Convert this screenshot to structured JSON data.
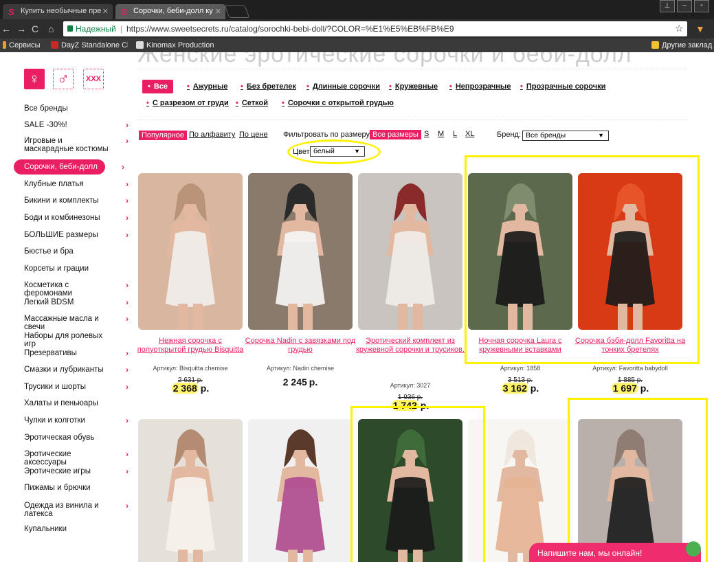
{
  "browser": {
    "tabs": [
      {
        "label": "Купить необычные пре",
        "active": false
      },
      {
        "label": "Сорочки, беби-долл ку",
        "active": true
      }
    ],
    "secure_label": "Надежный",
    "url": "https://www.sweetsecrets.ru/catalog/sorochki-bebi-doll/?COLOR=%E1%E5%EB%FB%E9",
    "bookmarks": [
      "Сервисы",
      "DayZ Standalone Che",
      "Kinomax Production"
    ],
    "other_bookmarks": "Другие заклад"
  },
  "page": {
    "heading": "Женские эротические сорочки и беби-долл"
  },
  "genders": {
    "female": "♀",
    "male": "♂",
    "xxx": "XXX"
  },
  "sidebar": {
    "items": [
      {
        "label": "Все бренды",
        "chev": false
      },
      {
        "label": "SALE -30%!",
        "chev": true
      },
      {
        "label": "Игровые и маскарадные костюмы",
        "chev": true
      },
      {
        "label": "Сорочки, беби-долл",
        "chev": true,
        "active": true
      },
      {
        "label": "Клубные платья",
        "chev": true
      },
      {
        "label": "Бикини и комплекты",
        "chev": true
      },
      {
        "label": "Боди и комбинезоны",
        "chev": true
      },
      {
        "label": "БОЛЬШИЕ размеры",
        "chev": true
      },
      {
        "label": "Бюстье и бра",
        "chev": false
      },
      {
        "label": "Корсеты и грации",
        "chev": false
      },
      {
        "label": "Косметика с феромонами",
        "chev": true
      },
      {
        "label": "Легкий BDSM",
        "chev": true
      },
      {
        "label": "Массажные масла и свечи",
        "chev": true
      },
      {
        "label": "Наборы для ролевых игр",
        "chev": false
      },
      {
        "label": "Презервативы",
        "chev": true
      },
      {
        "label": "Смазки и лубриканты",
        "chev": true
      },
      {
        "label": "Трусики и шорты",
        "chev": true
      },
      {
        "label": "Халаты и пеньюары",
        "chev": false
      },
      {
        "label": "Чулки и колготки",
        "chev": true
      },
      {
        "label": "Эротическая обувь",
        "chev": false
      },
      {
        "label": "Эротические аксессуары",
        "chev": true
      },
      {
        "label": "Эротические игры",
        "chev": true
      },
      {
        "label": "Пижамы и брючки",
        "chev": false
      },
      {
        "label": "Одежда из винила и латекса",
        "chev": true
      },
      {
        "label": "Купальники",
        "chev": false
      }
    ]
  },
  "categories": {
    "row1": [
      "Все",
      "Ажурные",
      "Без бретелек",
      "Длинные сорочки",
      "Кружевные",
      "Непрозрачные",
      "Прозрачные сорочки"
    ],
    "row2": [
      "С разрезом от груди",
      "Сеткой",
      "Сорочки с открытой грудью"
    ]
  },
  "sorting": {
    "options": [
      "Популярное",
      "По алфавиту",
      "По цене"
    ],
    "size_label": "Фильтровать по размеру:",
    "sizes": [
      "Все размеры",
      "S",
      "M",
      "L",
      "XL"
    ],
    "brand_label": "Бренд:",
    "brand_value": "Все бренды",
    "color_label": "Цвет:",
    "color_value": "белый"
  },
  "products": [
    {
      "name": "Нежная сорочка с полуоткрытой грудью Bisquitta",
      "article": "Артикул: Bisquitta chemise",
      "old_price": "2 631 р.",
      "price": "2 368",
      "currency": "р."
    },
    {
      "name": "Сорочка Nadin с завязками под грудью",
      "article": "Артикул: Nadin chemise",
      "old_price": "",
      "price": "2 245",
      "currency": "р."
    },
    {
      "name": "Эротический комплект из кружевной сорочки и трусиков.",
      "article": "Артикул: 3027",
      "old_price": "1 936 р.",
      "price": "1 742",
      "currency": "р."
    },
    {
      "name": "Ночная сорочка Laura с кружевными вставками",
      "article": "Артикул: 1858",
      "old_price": "3 513 р.",
      "price": "3 162",
      "currency": "р."
    },
    {
      "name": "Сорочка бэби-долл Favoritta на тонких бретелях",
      "article": "Артикул: Favoritta babydoll",
      "old_price": "1 885 р.",
      "price": "1 697",
      "currency": "р."
    }
  ],
  "chat": {
    "label": "Напишите нам, мы онлайн!"
  },
  "colors": {
    "accent": "#e91e63",
    "highlight": "#fff200"
  }
}
